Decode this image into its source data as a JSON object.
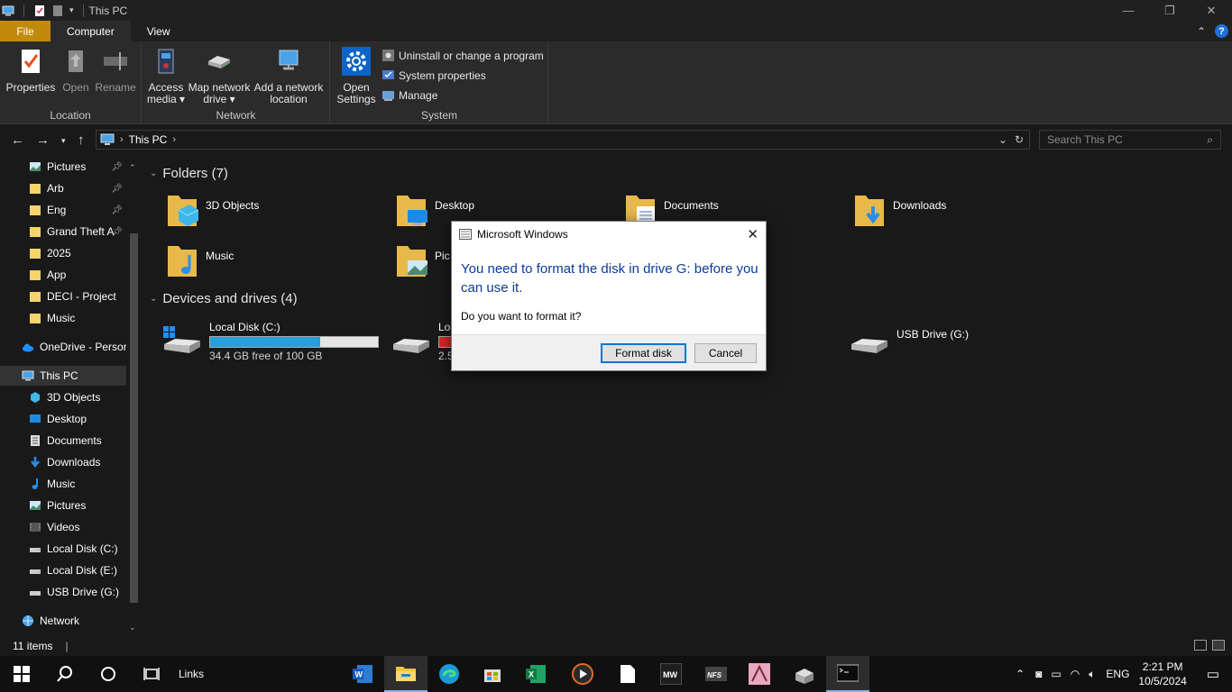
{
  "window": {
    "title": "This PC",
    "controls": {
      "minimize": "—",
      "restore": "❐",
      "close": "✕"
    }
  },
  "tabs": [
    {
      "label": "File"
    },
    {
      "label": "Computer"
    },
    {
      "label": "View"
    }
  ],
  "ribbon": {
    "location": {
      "label": "Location",
      "buttons": [
        {
          "label": "Properties"
        },
        {
          "label": "Open"
        },
        {
          "label": "Rename"
        }
      ]
    },
    "network": {
      "label": "Network",
      "buttons": [
        {
          "line1": "Access",
          "line2": "media ▾"
        },
        {
          "line1": "Map network",
          "line2": "drive ▾"
        },
        {
          "line1": "Add a network",
          "line2": "location"
        }
      ]
    },
    "system": {
      "label": "System",
      "open_settings": {
        "line1": "Open",
        "line2": "Settings"
      },
      "small": [
        {
          "label": "Uninstall or change a program"
        },
        {
          "label": "System properties"
        },
        {
          "label": "Manage"
        }
      ]
    }
  },
  "address": {
    "path": "This PC",
    "search_placeholder": "Search This PC"
  },
  "nav_pane": {
    "quick": [
      {
        "label": "Pictures",
        "icon": "pictures-icon",
        "pinned": true
      },
      {
        "label": "Arb",
        "icon": "folder-icon",
        "pinned": true
      },
      {
        "label": "Eng",
        "icon": "folder-icon",
        "pinned": true
      },
      {
        "label": "Grand Theft A",
        "icon": "folder-icon",
        "pinned": true
      },
      {
        "label": "2025",
        "icon": "folder-icon",
        "pinned": false
      },
      {
        "label": "App",
        "icon": "folder-icon",
        "pinned": false
      },
      {
        "label": "DECI - Project",
        "icon": "folder-icon",
        "pinned": false
      },
      {
        "label": "Music",
        "icon": "folder-icon",
        "pinned": false
      }
    ],
    "onedrive": "OneDrive - Persor",
    "this_pc": "This PC",
    "pc_items": [
      {
        "label": "3D Objects",
        "icon": "3d-objects-icon"
      },
      {
        "label": "Desktop",
        "icon": "desktop-icon"
      },
      {
        "label": "Documents",
        "icon": "documents-icon"
      },
      {
        "label": "Downloads",
        "icon": "downloads-icon"
      },
      {
        "label": "Music",
        "icon": "music-icon"
      },
      {
        "label": "Pictures",
        "icon": "pictures-icon"
      },
      {
        "label": "Videos",
        "icon": "videos-icon"
      },
      {
        "label": "Local Disk (C:)",
        "icon": "drive-icon"
      },
      {
        "label": "Local Disk (E:)",
        "icon": "drive-icon"
      },
      {
        "label": "USB Drive (G:)",
        "icon": "usb-drive-icon"
      }
    ],
    "network": "Network"
  },
  "content": {
    "folders_header": "Folders (7)",
    "folders": [
      {
        "label": "3D Objects"
      },
      {
        "label": "Desktop"
      },
      {
        "label": "Documents"
      },
      {
        "label": "Downloads"
      },
      {
        "label": "Music"
      },
      {
        "label": "Pic"
      }
    ],
    "drives_header": "Devices and drives (4)",
    "drives": [
      {
        "label": "Local Disk (C:)",
        "sub": "34.4 GB free of 100 GB",
        "used_fraction": 0.656
      },
      {
        "label": "Lo",
        "sub": "2.5"
      },
      {
        "label": "USB Drive (G:)"
      }
    ]
  },
  "status": {
    "items": "11 items"
  },
  "taskbar": {
    "links": "Links",
    "lang": "ENG",
    "time": "2:21 PM",
    "date": "10/5/2024"
  },
  "dialog": {
    "title": "Microsoft Windows",
    "main": "You need to format the disk in drive G: before you can use it.",
    "sub": "Do you want to format it?",
    "format_btn": "Format disk",
    "cancel_btn": "Cancel",
    "main_color": "#0c3b9c"
  },
  "colors": {
    "accent": "#0078d7",
    "file_tab": "#c28a0c",
    "drive_bar": "#26a0da",
    "drive_bar_low": "#da2626"
  }
}
